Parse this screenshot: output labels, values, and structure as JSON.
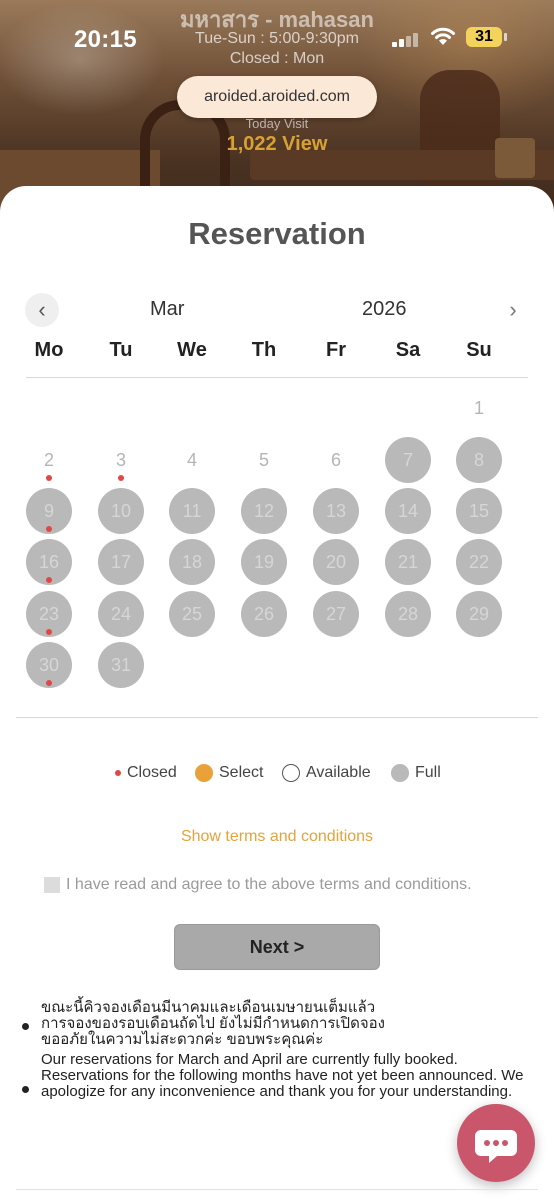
{
  "status_bar": {
    "time": "20:15",
    "battery": "31"
  },
  "header": {
    "restaurant_name": "มหาสาร - mahasan",
    "hours": "Tue-Sun : 5:00-9:30pm",
    "closed": "Closed : Mon",
    "url": "aroided.aroided.com",
    "today_visit_label": "Today Visit",
    "view_count": "1,022 View"
  },
  "page": {
    "title": "Reservation"
  },
  "calendar": {
    "prev_icon": "chevron-left-icon",
    "next_icon": "chevron-right-icon",
    "month": "Mar",
    "year": "2026",
    "weekdays": [
      "Mo",
      "Tu",
      "We",
      "Th",
      "Fr",
      "Sa",
      "Su"
    ],
    "first_weekday_index": 6,
    "days": [
      {
        "day": "1",
        "status": "available",
        "closed_dot": false
      },
      {
        "day": "2",
        "status": "available",
        "closed_dot": true
      },
      {
        "day": "3",
        "status": "available",
        "closed_dot": true
      },
      {
        "day": "4",
        "status": "available",
        "closed_dot": false
      },
      {
        "day": "5",
        "status": "available",
        "closed_dot": false
      },
      {
        "day": "6",
        "status": "available",
        "closed_dot": false
      },
      {
        "day": "7",
        "status": "full",
        "closed_dot": false
      },
      {
        "day": "8",
        "status": "full",
        "closed_dot": false
      },
      {
        "day": "9",
        "status": "full",
        "closed_dot": true
      },
      {
        "day": "10",
        "status": "full",
        "closed_dot": false
      },
      {
        "day": "11",
        "status": "full",
        "closed_dot": false
      },
      {
        "day": "12",
        "status": "full",
        "closed_dot": false
      },
      {
        "day": "13",
        "status": "full",
        "closed_dot": false
      },
      {
        "day": "14",
        "status": "full",
        "closed_dot": false
      },
      {
        "day": "15",
        "status": "full",
        "closed_dot": false
      },
      {
        "day": "16",
        "status": "full",
        "closed_dot": true
      },
      {
        "day": "17",
        "status": "full",
        "closed_dot": false
      },
      {
        "day": "18",
        "status": "full",
        "closed_dot": false
      },
      {
        "day": "19",
        "status": "full",
        "closed_dot": false
      },
      {
        "day": "20",
        "status": "full",
        "closed_dot": false
      },
      {
        "day": "21",
        "status": "full",
        "closed_dot": false
      },
      {
        "day": "22",
        "status": "full",
        "closed_dot": false
      },
      {
        "day": "23",
        "status": "full",
        "closed_dot": true
      },
      {
        "day": "24",
        "status": "full",
        "closed_dot": false
      },
      {
        "day": "25",
        "status": "full",
        "closed_dot": false
      },
      {
        "day": "26",
        "status": "full",
        "closed_dot": false
      },
      {
        "day": "27",
        "status": "full",
        "closed_dot": false
      },
      {
        "day": "28",
        "status": "full",
        "closed_dot": false
      },
      {
        "day": "29",
        "status": "full",
        "closed_dot": false
      },
      {
        "day": "30",
        "status": "full",
        "closed_dot": true
      },
      {
        "day": "31",
        "status": "full",
        "closed_dot": false
      }
    ]
  },
  "legend": {
    "closed": "Closed",
    "select": "Select",
    "available": "Available",
    "full": "Full",
    "colors": {
      "closed": "#e04848",
      "select": "#eba13a",
      "full": "#b9b9b9"
    }
  },
  "terms": {
    "link": "Show terms and conditions",
    "agree": "I have read and agree to the above terms and conditions."
  },
  "next_button": "Next >",
  "notices": [
    {
      "thai_lines": [
        "ขณะนี้คิวจองเดือนมีนาคมและเดือนเมษายนเต็มแล้ว",
        "การจองของรอบเดือนถัดไป ยังไม่มีกำหนดการเปิดจอง",
        "ขออภัยในความไม่สะดวกค่ะ ขอบพระคุณค่ะ"
      ]
    },
    {
      "english": "Our reservations for March and April are currently fully booked. Reservations for the following months have not yet been announced. We apologize for any inconvenience and thank you for your understanding."
    }
  ],
  "chat_icon": "chat-bubble-icon",
  "accent_color": "#e6a23c"
}
